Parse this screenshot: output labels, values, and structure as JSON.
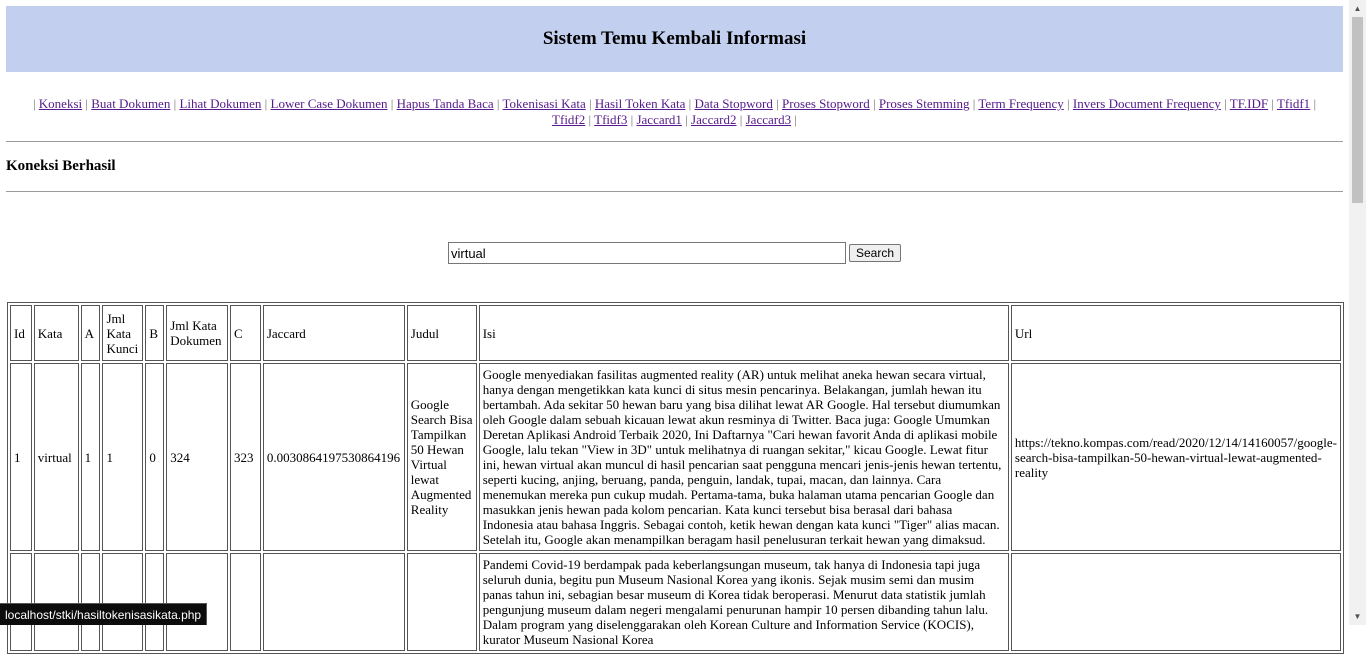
{
  "header": {
    "title": "Sistem Temu Kembali Informasi"
  },
  "nav": {
    "separator": "|",
    "items": [
      "Koneksi",
      "Buat Dokumen",
      "Lihat Dokumen",
      "Lower Case Dokumen",
      "Hapus Tanda Baca",
      "Tokenisasi Kata",
      "Hasil Token Kata",
      "Data Stopword",
      "Proses Stopword",
      "Proses Stemming",
      "Term Frequency",
      "Invers Document Frequency",
      "TF.IDF",
      "Tfidf1",
      "Tfidf2",
      "Tfidf3",
      "Jaccard1",
      "Jaccard2",
      "Jaccard3"
    ]
  },
  "status": {
    "message": "Koneksi Berhasil"
  },
  "search": {
    "value": "virtual",
    "button_label": "Search"
  },
  "table": {
    "headers": {
      "id": "Id",
      "kata": "Kata",
      "a": "A",
      "jml_kata_kunci": "Jml Kata Kunci",
      "b": "B",
      "jml_kata_dokumen": "Jml Kata Dokumen",
      "c": "C",
      "jaccard": "Jaccard",
      "judul": "Judul",
      "isi": "Isi",
      "url": "Url"
    },
    "rows": [
      {
        "id": "1",
        "kata": "virtual",
        "a": "1",
        "jml_kata_kunci": "1",
        "b": "0",
        "jml_kata_dokumen": "324",
        "c": "323",
        "jaccard": "0.0030864197530864196",
        "judul": "Google Search Bisa Tampilkan 50 Hewan Virtual lewat Augmented Reality",
        "isi": "Google menyediakan fasilitas augmented reality (AR) untuk melihat aneka hewan secara virtual, hanya dengan mengetikkan kata kunci di situs mesin pencarinya. Belakangan, jumlah hewan itu bertambah. Ada sekitar 50 hewan baru yang bisa dilihat lewat AR Google. Hal tersebut diumumkan oleh Google dalam sebuah kicauan lewat akun resminya di Twitter. Baca juga: Google Umumkan Deretan Aplikasi Android Terbaik 2020, Ini Daftarnya \"Cari hewan favorit Anda di aplikasi mobile Google, lalu tekan \"View in 3D\" untuk melihatnya di ruangan sekitar,\" kicau Google. Lewat fitur ini, hewan virtual akan muncul di hasil pencarian saat pengguna mencari jenis-jenis hewan tertentu, seperti kucing, anjing, beruang, panda, penguin, landak, tupai, macan, dan lainnya. Cara menemukan mereka pun cukup mudah. Pertama-tama, buka halaman utama pencarian Google dan masukkan jenis hewan pada kolom pencarian. Kata kunci tersebut bisa berasal dari bahasa Indonesia atau bahasa Inggris. Sebagai contoh, ketik hewan dengan kata kunci \"Tiger\" alias macan. Setelah itu, Google akan menampilkan beragam hasil penelusuran terkait hewan yang dimaksud.",
        "url": "https://tekno.kompas.com/read/2020/12/14/14160057/google-search-bisa-tampilkan-50-hewan-virtual-lewat-augmented-reality"
      },
      {
        "id": "",
        "kata": "",
        "a": "",
        "jml_kata_kunci": "",
        "b": "",
        "jml_kata_dokumen": "",
        "c": "",
        "jaccard": "",
        "judul": "",
        "isi": "Pandemi Covid-19 berdampak pada keberlangsungan museum, tak hanya di Indonesia tapi juga seluruh dunia, begitu pun Museum Nasional Korea yang ikonis. Sejak musim semi dan musim panas tahun ini, sebagian besar museum di Korea tidak beroperasi. Menurut data statistik jumlah pengunjung museum dalam negeri mengalami penurunan hampir 10 persen dibanding tahun lalu. Dalam program yang diselenggarakan oleh Korean Culture and Information Service (KOCIS), kurator Museum Nasional Korea",
        "url": ""
      }
    ]
  },
  "statusbar": {
    "url": "localhost/stki/hasiltokenisasikata.php"
  },
  "scrollbar": {
    "up_icon": "▲",
    "down_icon": "▼"
  }
}
